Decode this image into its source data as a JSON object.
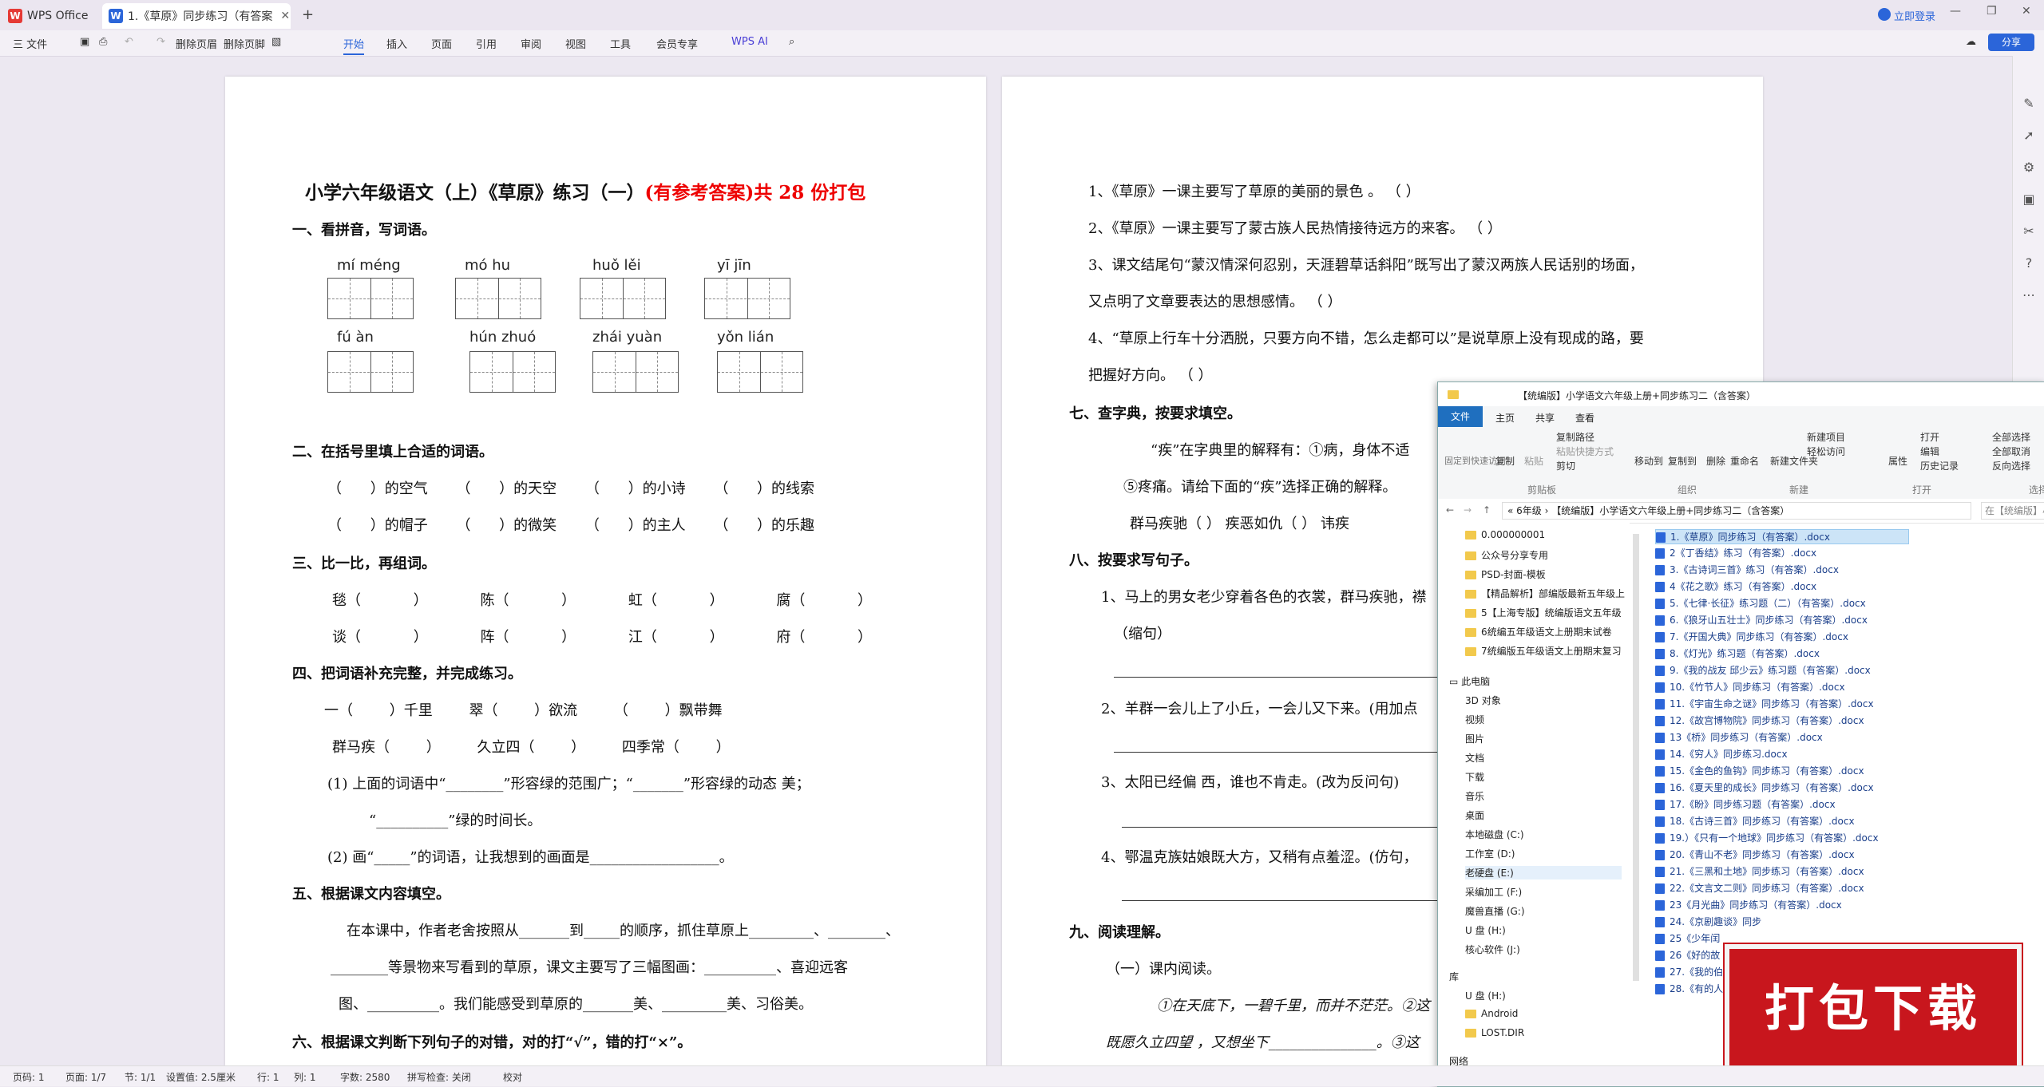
{
  "tabs": {
    "app": "WPS Office",
    "doc": "1.《草原》同步练习（有答案"
  },
  "topbar": {
    "login": "立即登录",
    "share": "分享"
  },
  "menu": {
    "file": "三 文件",
    "delete_header": "删除页眉",
    "delete_footer": "删除页脚",
    "home": "开始",
    "insert": "插入",
    "page": "页面",
    "reference": "引用",
    "review": "审阅",
    "view": "视图",
    "tools": "工具",
    "member": "会员专享",
    "ai": "WPS AI"
  },
  "page1": {
    "title": "小学六年级语文（上）《草原》练习（一）",
    "title_red": "(有参考答案)共 28 份打包",
    "s1": "一、看拼音，写词语。",
    "pinyin_row1": [
      "mí méng",
      "mó hu",
      "huǒ lěi",
      "yī jīn"
    ],
    "pinyin_row2": [
      "fú àn",
      "hún zhuó",
      "zhái yuàn",
      "yǒn lián"
    ],
    "s2": "二、在括号里填上合适的词语。",
    "s2_l1": "（ ）的空气 （ ）的天空 （ ）的小诗 （ ）的线索",
    "s2_l2": "（ ）的帽子 （ ）的微笑 （ ）的主人 （ ）的乐趣",
    "s3": "三、比一比，再组词。",
    "s3_l1": "毯（ ） 陈（ ） 虹（ ） 腐（ ）",
    "s3_l2": "谈（ ） 阵（ ） 江（ ） 府（ ）",
    "s4": "四、把词语补充完整，并完成练习。",
    "s4_l1": "一（ ）千里 翠（ ）欲流 （ ）飘带舞",
    "s4_l2": "群马疾（ ） 久立四（ ） 四季常（ ）",
    "s4_l3": "(1) 上面的词语中“________”形容绿的范围广；“_______”形容绿的动态 美；",
    "s4_l4": "“__________”绿的时间长。",
    "s4_l5": "(2) 画“_____”的词语，让我想到的画面是__________________。",
    "s5": "五、根据课文内容填空。",
    "s5_l1": "在本课中，作者老舍按照从_______到_____的顺序，抓住草原上_________、________、",
    "s5_l2": "________等景物来写看到的草原，课文主要写了三幅图画：__________、喜迎远客",
    "s5_l3": "图、__________。我们能感受到草原的_______美、_________美、习俗美。",
    "s6": "六、根据课文判断下列句子的对错，对的打“√”，错的打“×”。"
  },
  "page2": {
    "l1": "1、《草原》一课主要写了草原的美丽的景色 。 （ ）",
    "l2": "2、《草原》一课主要写了蒙古族人民热情接待远方的来客。 （ ）",
    "l3": "3、课文结尾句“蒙汉情深何忍别，天涯碧草话斜阳”既写出了蒙汉两族人民话别的场面，",
    "l4": "又点明了文章要表达的思想感情。 （ ）",
    "l5": "4、“草原上行车十分洒脱，只要方向不错，怎么走都可以”是说草原上没有现成的路，要",
    "l6": "把握好方向。 （ ）",
    "s7": "七、查字典，按要求填空。",
    "s7_l1": "“疾”在字典里的解释有：①病，身体不适",
    "s7_l2": "⑤疼痛。请给下面的“疾”选择正确的解释。",
    "s7_l3": "群马疾驰（ ） 疾恶如仇（ ） 讳疾",
    "s8": "八、按要求写句子。",
    "s8_l1": "1、马上的男女老少穿着各色的衣裳，群马疾驰，襟",
    "s8_l2": "（缩句）",
    "s8_l3": "2、羊群一会儿上了小丘，一会儿又下来。(用加点",
    "s8_l4": "3、太阳已经偏 西，谁也不肯走。(改为反问句)",
    "s8_l5": "4、鄂温克族姑娘既大方，又稍有点羞涩。(仿句，",
    "s9": "九、阅读理解。",
    "s9_l1": "（一）课内阅读。",
    "s9_l2": "①在天底下，一碧千里，而并不茫茫。②这",
    "s9_l3": "既愿久立四望 ，又想坐下_______________。③这"
  },
  "explorer": {
    "title": "【统编版】小学语文六年级上册+同步练习二（含答案）",
    "ribbon_tabs": [
      "文件",
      "主页",
      "共享",
      "查看"
    ],
    "ribbon_items": [
      "固定到快速访问",
      "复制",
      "粘贴",
      "复制路径",
      "粘贴快捷方式",
      "剪切",
      "移动到",
      "复制到",
      "删除",
      "重命名",
      "新建文件夹",
      "新建项目",
      "轻松访问",
      "属性",
      "打开",
      "编辑",
      "历史记录",
      "全部选择",
      "全部取消",
      "反向选择"
    ],
    "ribbon_groups": [
      "剪贴板",
      "组织",
      "新建",
      "打开",
      "选择"
    ],
    "address": "« 6年级 › 【统编版】小学语文六年级上册+同步练习二（含答案）",
    "search": "在【统编版】小学语文...",
    "nav_quick": [
      "0.000000001",
      "公众号分享专用",
      "PSD-封面-模板",
      "【精品解析】部编版最新五年级上",
      "5【上海专版】统编版语文五年级",
      "6统编五年级语文上册期末试卷",
      "7统编版五年级语文上册期末复习"
    ],
    "nav_pc": [
      "此电脑",
      "3D 对象",
      "视频",
      "图片",
      "文档",
      "下载",
      "音乐",
      "桌面",
      "本地磁盘 (C:)",
      "工作室 (D:)",
      "老硬盘 (E:)",
      "采编加工 (F:)",
      "魔兽直播 (G:)",
      "U 盘 (H:)",
      "核心软件 (J:)",
      "库",
      "U 盘 (H:)",
      "Android",
      "LOST.DIR",
      "网络"
    ],
    "files": [
      "1.《草原》同步练习（有答案）.docx",
      "2《丁香结》练习（有答案）.docx",
      "3.《古诗词三首》练习（有答案）.docx",
      "4《花之歌》练习（有答案）.docx",
      "5.《七律·长征》练习题（二）（有答案）.docx",
      "6.《狼牙山五壮士》同步练习（有答案）.docx",
      "7.《开国大典》同步练习（有答案）.docx",
      "8.《灯光》练习题（有答案）.docx",
      "9.《我的战友 邱少云》练习题（有答案）.docx",
      "10.《竹节人》同步练习（有答案）.docx",
      "11.《宇宙生命之谜》同步练习（有答案）.docx",
      "12.《故宫博物院》同步练习（有答案）.docx",
      "13《桥》同步练习（有答案）.docx",
      "14.《穷人》同步练习.docx",
      "15.《金色的鱼钩》同步练习（有答案）.docx",
      "16.《夏天里的成长》同步练习（有答案）.docx",
      "17.《盼》同步练习题（有答案）.docx",
      "18.《古诗三首》同步练习（有答案）.docx",
      "19.）《只有一个地球》同步练习（有答案）.docx",
      "20.《青山不老》同步练习（有答案）.docx",
      "21.《三黑和土地》同步练习（有答案）.docx",
      "22.《文言文二则》同步练习（有答案）.docx",
      "23《月光曲》同步练习（有答案）.docx",
      "24.《京剧趣谈》同步",
      "25《少年闰",
      "26《好的故",
      "27.《我的伯",
      "28.《有的人"
    ]
  },
  "banner": "打包下载",
  "status": {
    "page": "页码: 1",
    "pages": "页面: 1/7",
    "section": "节: 1/1",
    "setting": "设置值: 2.5厘米",
    "row": "行: 1",
    "col": "列: 1",
    "words": "字数: 2580",
    "spell": "拼写检查: 关闭",
    "proof": "校对"
  }
}
